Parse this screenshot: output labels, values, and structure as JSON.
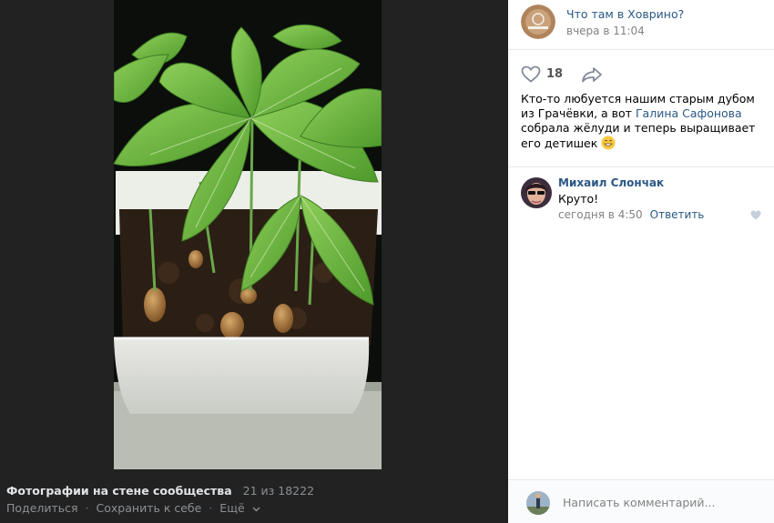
{
  "photo_footer": {
    "album_title": "Фотографии на стене сообщества",
    "counter": "21 из 18222",
    "share_label": "Поделиться",
    "save_label": "Сохранить к себе",
    "more_label": "Ещё"
  },
  "post": {
    "group_name": "Что там в Ховрино?",
    "date": "вчера в 11:04",
    "likes": "18",
    "text_before": "Кто-то любуется нашим старым дубом из Грачёвки, а вот ",
    "mention": "Галина Сафонова",
    "text_after": " собрала жёлуди и теперь выращивает его детишек "
  },
  "comment": {
    "author": "Михаил Слончак",
    "text": "Круто!",
    "date": "сегодня в 4:50",
    "reply_label": "Ответить"
  },
  "compose": {
    "placeholder": "Написать комментарий..."
  },
  "colors": {
    "link": "#2a5885",
    "dark_bg": "#222222",
    "muted": "#828282"
  }
}
